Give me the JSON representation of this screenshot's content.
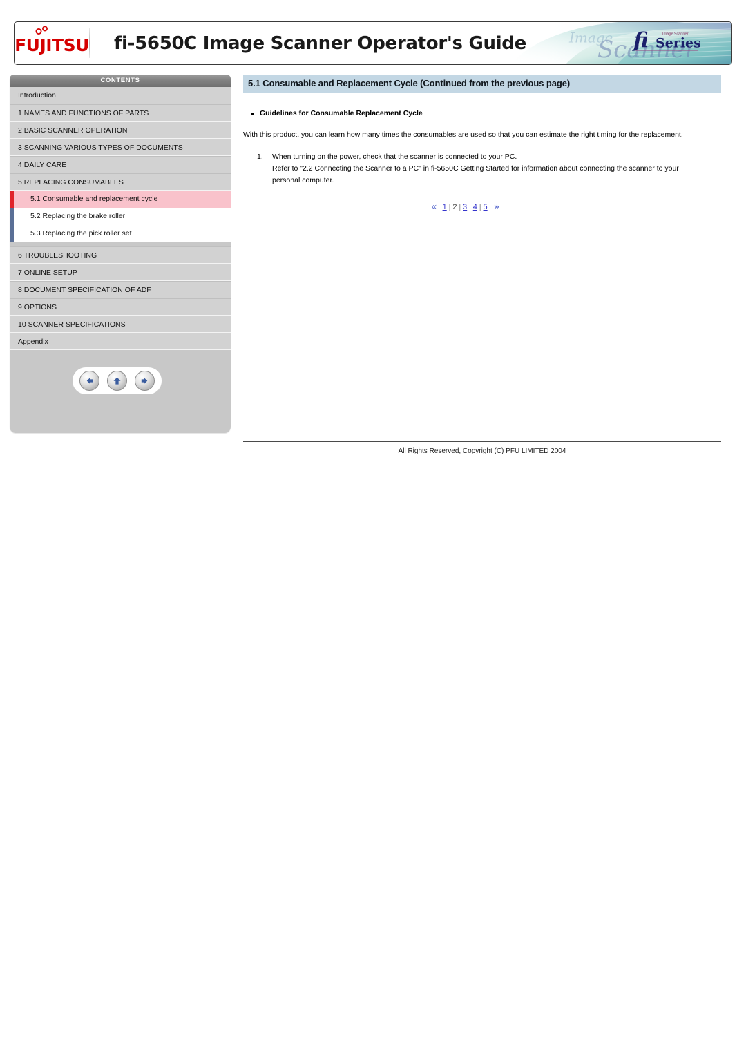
{
  "header": {
    "brand": "FUJITSU",
    "title": "fi-5650C Image Scanner Operator's Guide",
    "banner_logo": "fi",
    "banner_logo_sub": "Series",
    "banner_watermark": "Image Scanner",
    "banner_tagline": "Image Scanner"
  },
  "sidebar": {
    "contents_label": "CONTENTS",
    "items": [
      {
        "label": "Introduction",
        "type": "chapter"
      },
      {
        "label": "1 NAMES AND FUNCTIONS OF PARTS",
        "type": "chapter"
      },
      {
        "label": "2 BASIC SCANNER OPERATION",
        "type": "chapter"
      },
      {
        "label": "3 SCANNING VARIOUS TYPES OF DOCUMENTS",
        "type": "chapter"
      },
      {
        "label": "4 DAILY CARE",
        "type": "chapter"
      },
      {
        "label": "5 REPLACING CONSUMABLES",
        "type": "chapter"
      },
      {
        "label": "5.1 Consumable and replacement cycle",
        "type": "section",
        "active": true
      },
      {
        "label": "5.2 Replacing the brake roller",
        "type": "section",
        "active": false
      },
      {
        "label": "5.3 Replacing the pick roller set",
        "type": "section",
        "active": false
      },
      {
        "label": "6 TROUBLESHOOTING",
        "type": "chapter"
      },
      {
        "label": "7 ONLINE SETUP",
        "type": "chapter"
      },
      {
        "label": "8 DOCUMENT SPECIFICATION OF ADF",
        "type": "chapter"
      },
      {
        "label": "9 OPTIONS",
        "type": "chapter"
      },
      {
        "label": "10 SCANNER SPECIFICATIONS",
        "type": "chapter"
      },
      {
        "label": "Appendix",
        "type": "chapter"
      }
    ],
    "nav_buttons": [
      {
        "name": "back-arrow-button",
        "icon": "arrow-left-icon"
      },
      {
        "name": "up-arrow-button",
        "icon": "arrow-up-icon"
      },
      {
        "name": "forward-arrow-button",
        "icon": "arrow-right-icon"
      }
    ]
  },
  "main": {
    "page_title": "5.1 Consumable and Replacement Cycle (Continued from the previous page)",
    "bullet_heading": "Guidelines for Consumable Replacement Cycle",
    "paragraph": "With this product, you can learn how many times the consumables are used so that you can estimate the right timing for the replacement.",
    "steps": [
      {
        "number": "1.",
        "line1": "When turning on the power, check that the scanner is connected to your PC.",
        "line2": "Refer to \"2.2 Connecting the Scanner to a PC\" in fi-5650C Getting Started for information about connecting the scanner to your",
        "line3": "personal computer."
      }
    ]
  },
  "pager": {
    "prev_symbol": "«",
    "next_symbol": "»",
    "separator": "|",
    "pages": [
      {
        "label": "1",
        "current": false
      },
      {
        "label": "2",
        "current": true
      },
      {
        "label": "3",
        "current": false
      },
      {
        "label": "4",
        "current": false
      },
      {
        "label": "5",
        "current": false
      }
    ]
  },
  "footer": {
    "copyright": "All Rights Reserved, Copyright (C) PFU LIMITED 2004"
  },
  "colors": {
    "brand_red": "#d50000",
    "title_bar_blue": "#c3d7e4",
    "active_item_pink": "#f9c2cb",
    "active_accent_red": "#e0242b",
    "section_accent_blue": "#5a6f96",
    "link_blue": "#3333cc"
  }
}
